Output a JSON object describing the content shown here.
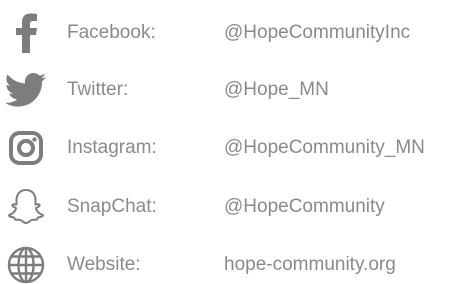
{
  "colors": {
    "icon": "#7d7d7d",
    "text": "#8a8a8a"
  },
  "items": [
    {
      "icon": "facebook-icon",
      "label": "Facebook:",
      "value": "@HopeCommunityInc"
    },
    {
      "icon": "twitter-icon",
      "label": "Twitter:",
      "value": "@Hope_MN"
    },
    {
      "icon": "instagram-icon",
      "label": "Instagram:",
      "value": "@HopeCommunity_MN"
    },
    {
      "icon": "snapchat-icon",
      "label": "SnapChat:",
      "value": "@HopeCommunity"
    },
    {
      "icon": "globe-icon",
      "label": "Website:",
      "value": "hope-community.org"
    }
  ]
}
